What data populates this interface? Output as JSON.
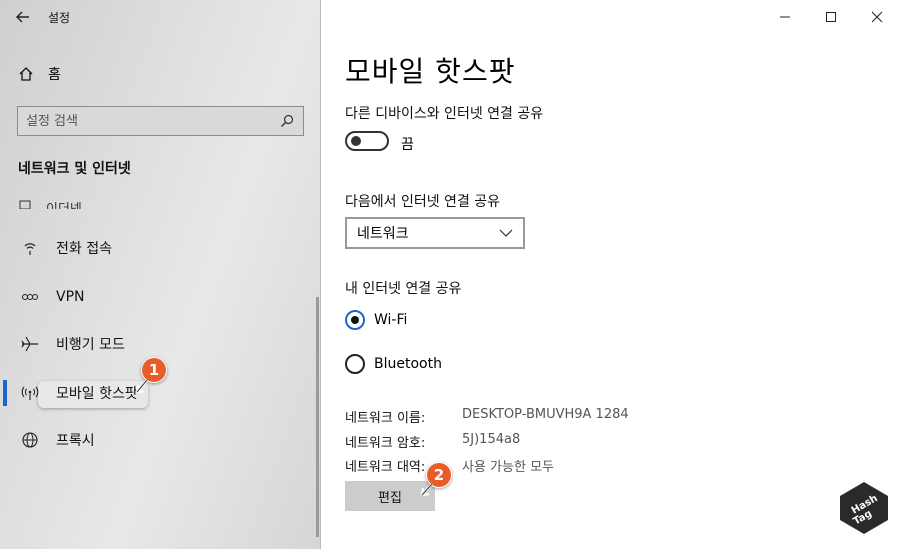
{
  "window": {
    "title": "설정",
    "minimize": "—",
    "maximize": "☐",
    "close": "✕"
  },
  "sidebar": {
    "back_icon": "arrow-left-icon",
    "home_label": "홈",
    "search_placeholder": "설정 검색",
    "section_title": "네트워크 및 인터넷",
    "cut_item_label": "이더넷",
    "items": [
      {
        "label": "전화 접속",
        "icon": "dialup-icon"
      },
      {
        "label": "VPN",
        "icon": "vpn-icon"
      },
      {
        "label": "비행기 모드",
        "icon": "airplane-icon"
      },
      {
        "label": "모바일 핫스팟",
        "icon": "hotspot-icon",
        "active": true
      },
      {
        "label": "프록시",
        "icon": "globe-icon"
      }
    ]
  },
  "annotations": {
    "badge1": "1",
    "badge2": "2"
  },
  "main": {
    "title": "모바일 핫스팟",
    "share_label": "다른 디바이스와 인터넷 연결 공유",
    "toggle_state": "끔",
    "share_from_label": "다음에서 인터넷 연결 공유",
    "dropdown_value": "네트워크",
    "share_over_label": "내 인터넷 연결 공유",
    "radio_wifi": "Wi-Fi",
    "radio_bluetooth": "Bluetooth",
    "selected_radio": "Wi-Fi",
    "network_name_key": "네트워크 이름:",
    "network_name_value": "DESKTOP-BMUVH9A 1284",
    "network_pw_key": "네트워크 암호:",
    "network_pw_value": "5J)154a8",
    "network_band_key": "네트워크 대역:",
    "network_band_value": "사용 가능한 모두",
    "edit_button": "편집"
  },
  "watermark": {
    "line1": "Hash",
    "line2": "Tag"
  },
  "colors": {
    "accent": "#1a66cc",
    "badge": "#e85c2a"
  }
}
